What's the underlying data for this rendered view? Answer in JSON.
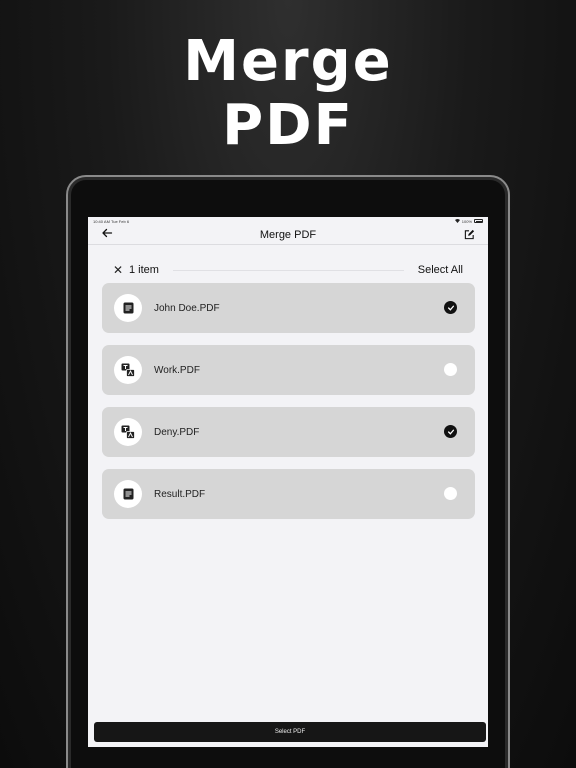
{
  "headline": {
    "line1": "Merge",
    "line2": "PDF"
  },
  "status_bar": {
    "time": "10:40 AM",
    "date": "Tue Feb 6",
    "battery": "100%"
  },
  "navbar": {
    "title": "Merge PDF",
    "back_icon": "arrow-left-icon",
    "edit_icon": "edit-square-icon"
  },
  "selection": {
    "close_label": "✕",
    "count": "1 item",
    "select_all_label": "Select All"
  },
  "files": [
    {
      "name": "John Doe.PDF",
      "icon": "document-icon",
      "selected": true
    },
    {
      "name": "Work.PDF",
      "icon": "translate-icon",
      "selected": false
    },
    {
      "name": "Deny.PDF",
      "icon": "translate-icon",
      "selected": true
    },
    {
      "name": "Result.PDF",
      "icon": "document-icon",
      "selected": false
    }
  ],
  "bottom_button": {
    "label": "Select PDF"
  },
  "colors": {
    "screen_bg": "#f3f3f6",
    "item_bg": "#d6d6d6",
    "accent": "#111111"
  }
}
